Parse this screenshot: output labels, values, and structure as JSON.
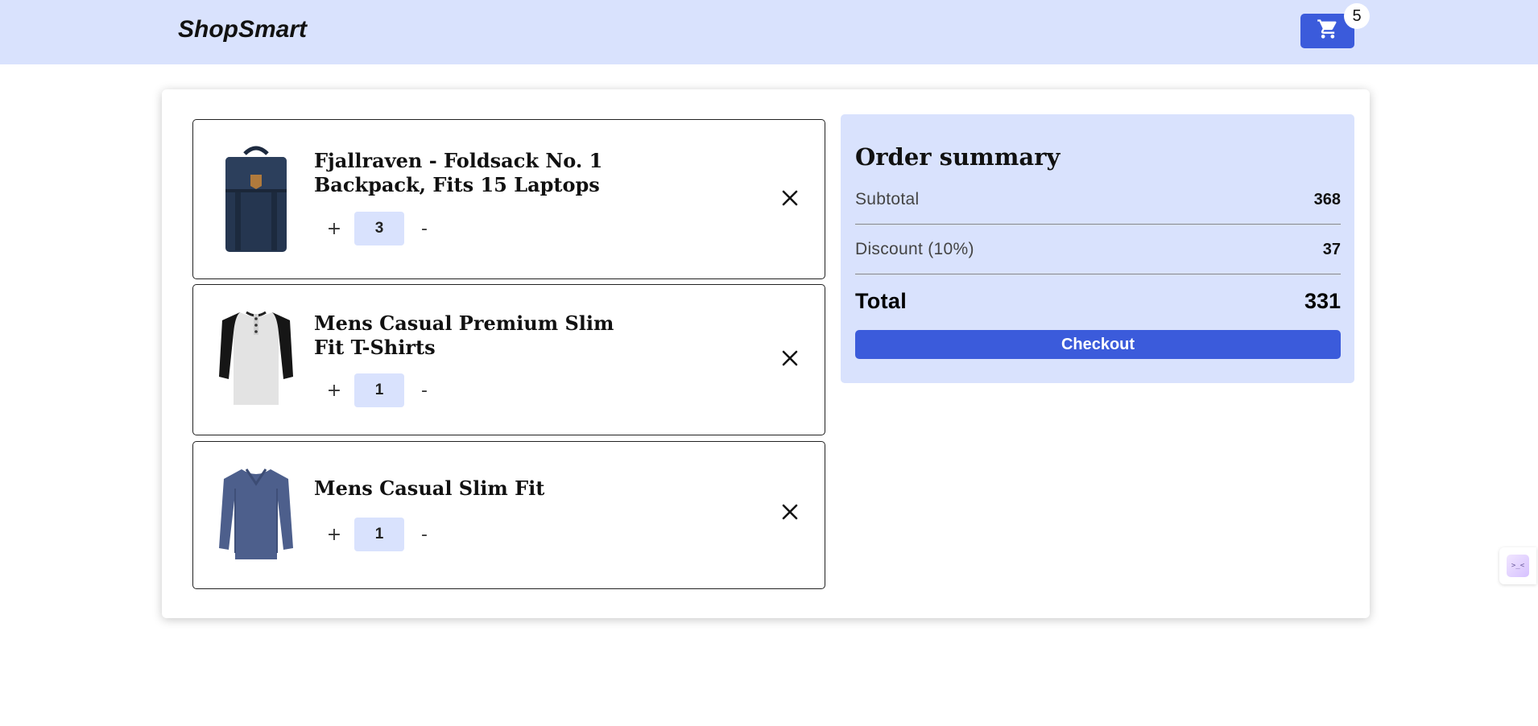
{
  "header": {
    "brand": "ShopSmart",
    "cart_count": "5",
    "cart_icon": "cart-icon"
  },
  "cart_items": [
    {
      "title": "Fjallraven - Foldsack No. 1 Backpack, Fits 15 Laptops",
      "quantity": "3",
      "plus_label": "+",
      "minus_label": "-",
      "image": "backpack-image"
    },
    {
      "title": "Mens Casual Premium Slim Fit T-Shirts",
      "quantity": "1",
      "plus_label": "+",
      "minus_label": "-",
      "image": "raglan-tshirt-image"
    },
    {
      "title": "Mens Casual Slim Fit",
      "quantity": "1",
      "plus_label": "+",
      "minus_label": "-",
      "image": "longsleeve-shirt-image"
    }
  ],
  "summary": {
    "title": "Order summary",
    "subtotal_label": "Subtotal",
    "subtotal_value": "368",
    "discount_label": "Discount (10%)",
    "discount_value": "37",
    "total_label": "Total",
    "total_value": "331",
    "checkout_label": "Checkout"
  },
  "colors": {
    "header_bg": "#d9e2fd",
    "accent": "#3b5bdb",
    "qty_bg": "#d9e2fd"
  }
}
